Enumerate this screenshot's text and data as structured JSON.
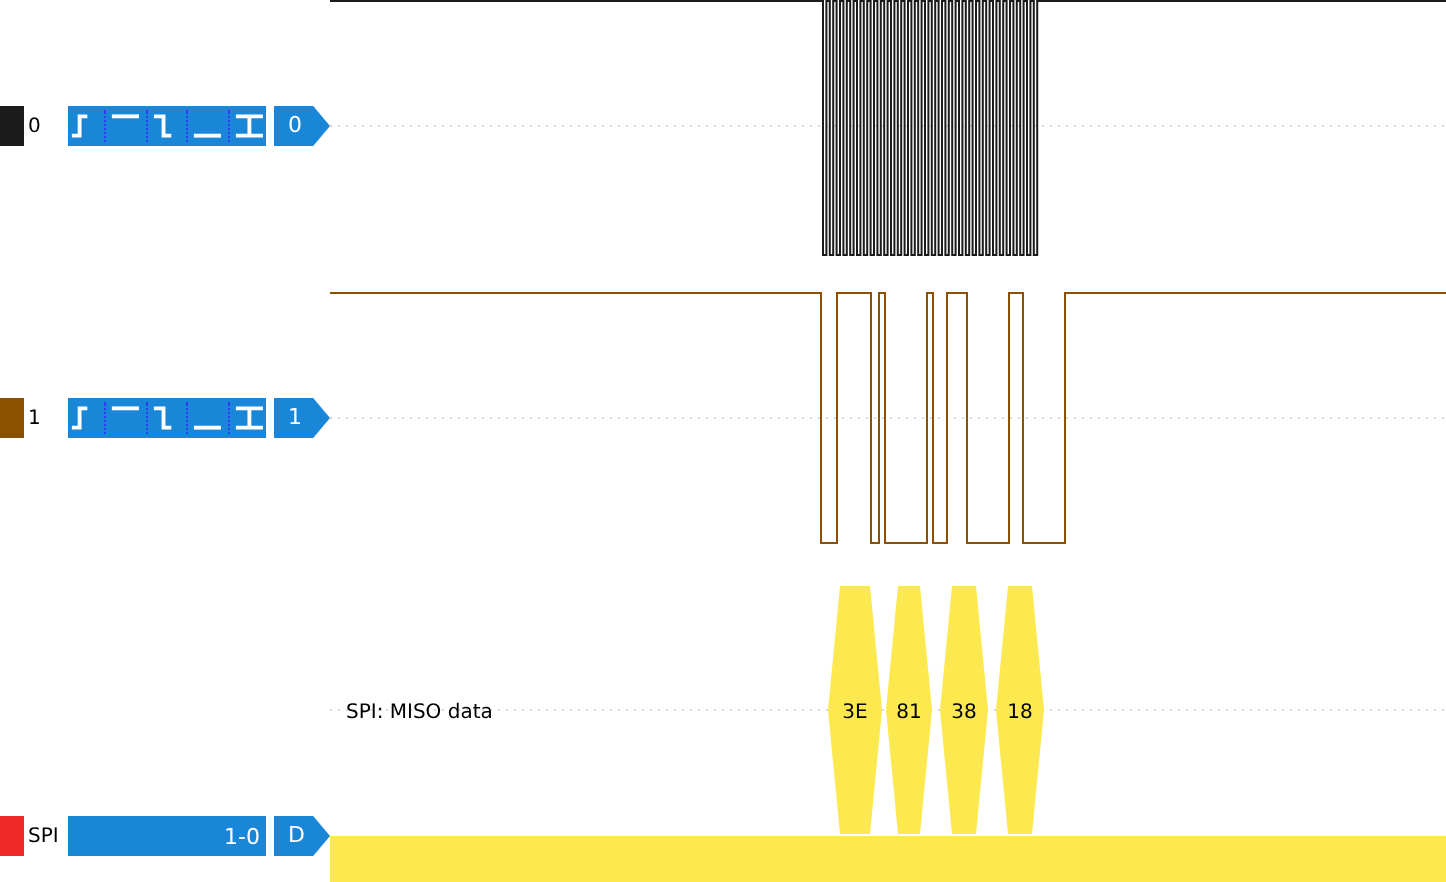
{
  "channels": [
    {
      "name": "0",
      "color": "#1b1b1b",
      "badge": "0",
      "kind": "clock"
    },
    {
      "name": "1",
      "color": "#8b5000",
      "badge": "1",
      "kind": "data"
    }
  ],
  "decoder": {
    "name": "SPI",
    "color": "#ef2929",
    "channels": "1-0",
    "badge": "D",
    "row_title": "SPI: MISO data",
    "annotations": [
      "3E",
      "81",
      "38",
      "18"
    ]
  }
}
